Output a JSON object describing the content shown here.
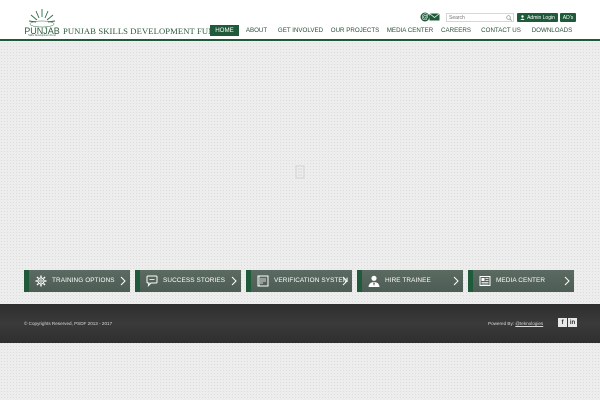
{
  "header": {
    "logo_text": "PUNJAB",
    "logo_sub": "Skills Development Fund",
    "org_name": "PUNJAB SKILLS DEVELOPMENT FUND",
    "search_placeholder": "Search",
    "admin_login_label": "Admin Login",
    "ads_label": "AD's"
  },
  "nav": {
    "items": [
      "HOME",
      "ABOUT",
      "GET INVOLVED",
      "OUR PROJECTS",
      "MEDIA CENTER",
      "CAREERS",
      "CONTACT US",
      "DOWNLOADS"
    ],
    "active": "HOME"
  },
  "tiles": [
    {
      "label": "TRAINING OPTIONS",
      "icon": "gear-icon"
    },
    {
      "label": "SUCCESS STORIES",
      "icon": "chat-bubble-icon"
    },
    {
      "label": "VERIFICATION SYSTEM",
      "icon": "certificate-icon"
    },
    {
      "label": "HIRE TRAINEE",
      "icon": "person-tie-icon"
    },
    {
      "label": "MEDIA CENTER",
      "icon": "newspaper-icon"
    }
  ],
  "footer": {
    "copyright": "© Copyrights Reserved, PSDF 2013 - 2017",
    "powered_by": "Powered By:",
    "powered_link": "@teknologies",
    "social": [
      "f",
      "in"
    ]
  },
  "colors": {
    "brand_green": "#1f5a3a",
    "tile_gray": "#56665d",
    "footer_dark": "#333333",
    "page_bg": "#ededed"
  }
}
